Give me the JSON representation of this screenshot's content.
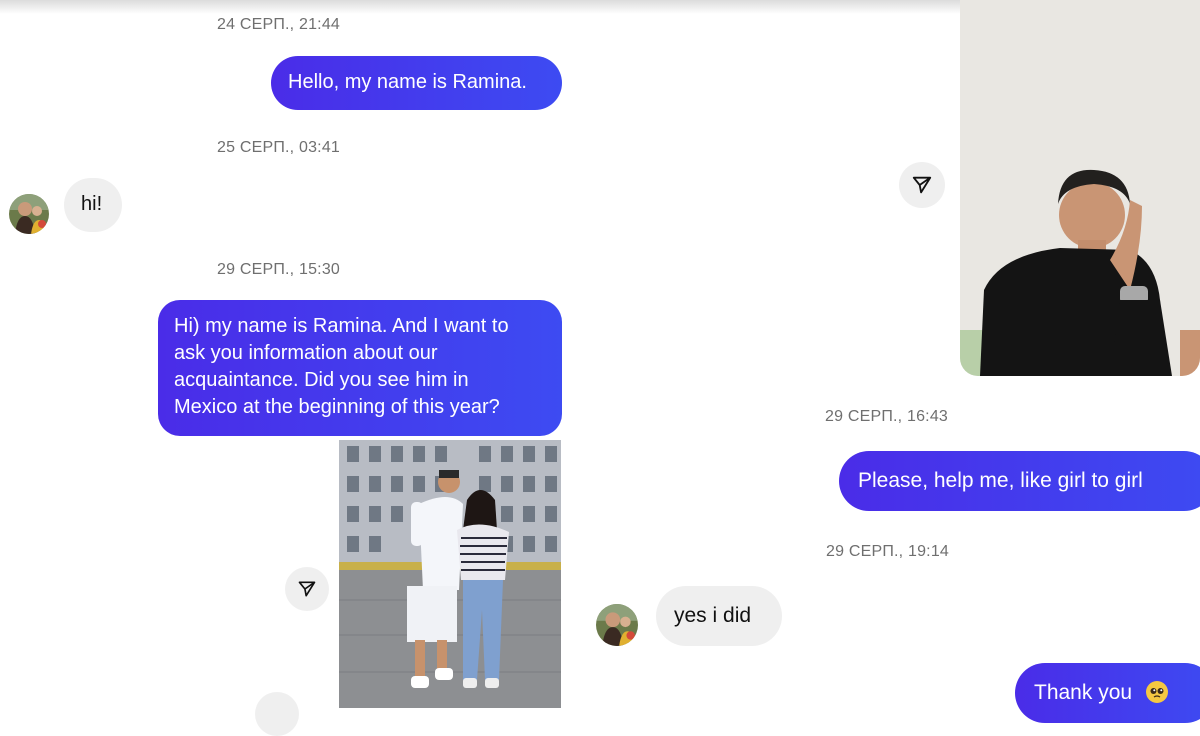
{
  "timestamps": {
    "t1": "24 СЕРП., 21:44",
    "t2": "25 СЕРП., 03:41",
    "t3": "29 СЕРП., 15:30",
    "t4": "29 СЕРП., 16:43",
    "t5": "29 СЕРП., 19:14"
  },
  "messages": {
    "m1": "Hello, my name is Ramina.",
    "m2": "hi!",
    "m3": [
      "Hi) my name is Ramina. And I want to",
      "ask you information about our",
      "acquaintance. Did you see him in",
      "Mexico at the beginning of this year?"
    ],
    "m4": "Please, help me, like girl to girl",
    "m5": "yes i did",
    "m6": "Thank you"
  },
  "icons": {
    "share": "send-icon",
    "emoji": "pleading-face-emoji"
  },
  "colors": {
    "outgoing_bubble": "#4233ee",
    "incoming_bubble": "#efefef",
    "timestamp": "#6f6f6f"
  }
}
